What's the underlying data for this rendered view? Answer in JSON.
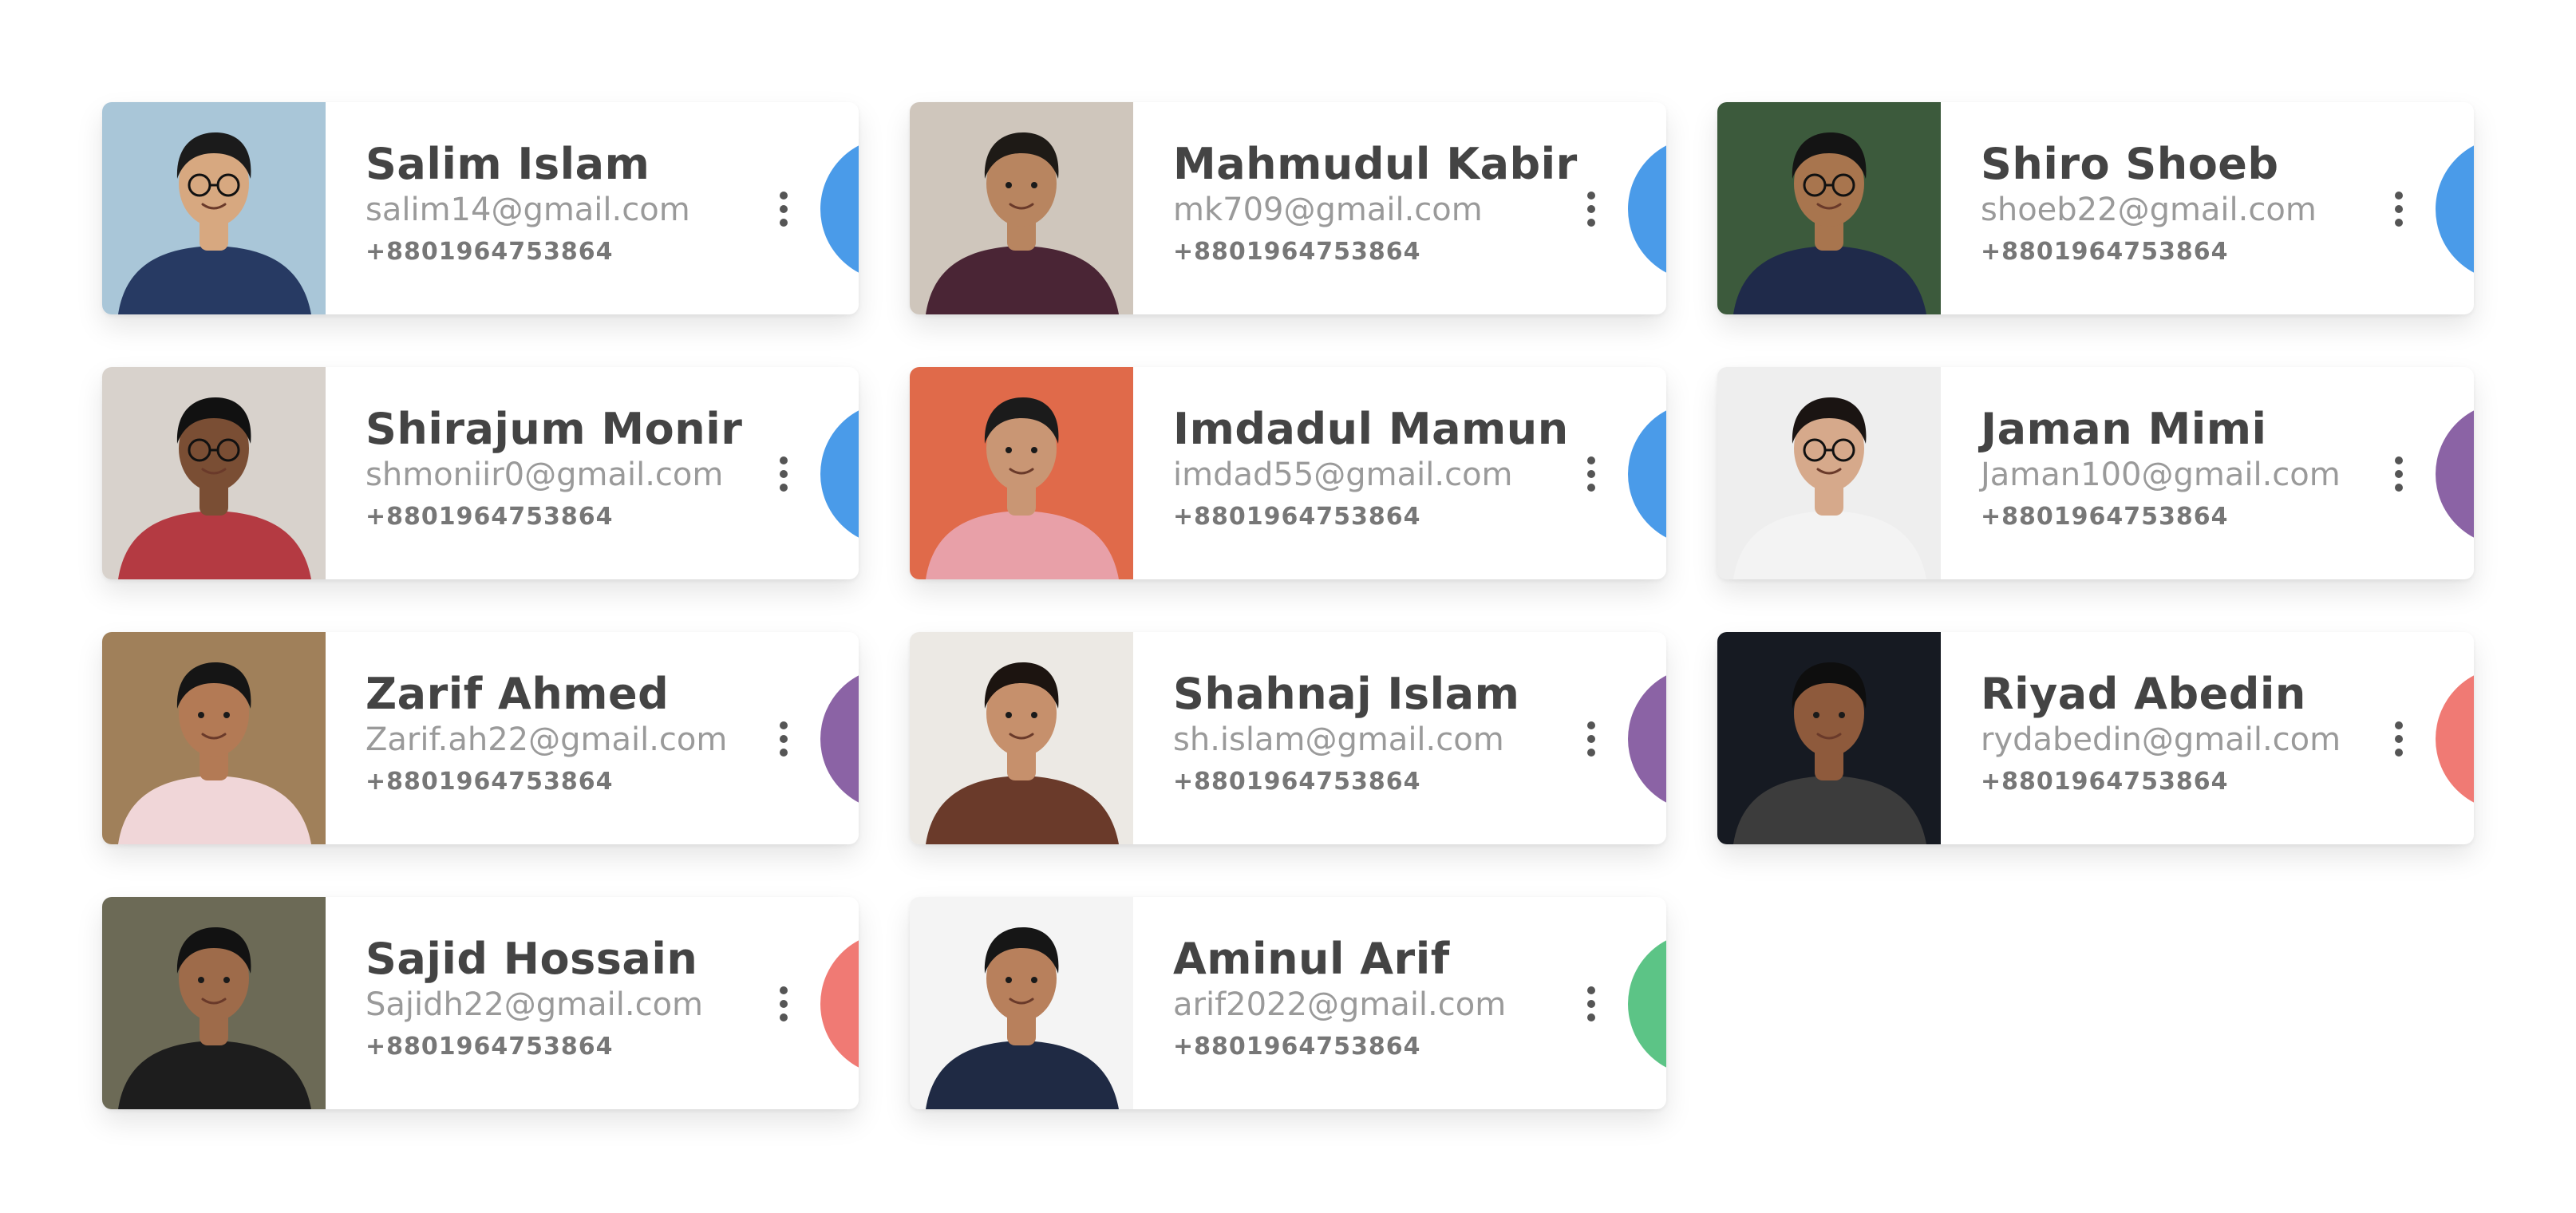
{
  "contacts": [
    {
      "name": "Salim Islam",
      "email": "salim14@gmail.com",
      "phone": "+8801964753864",
      "accent": "#4a9be9",
      "photo": {
        "bg": "#a9c6d8",
        "skin": "#d7a880",
        "hair": "#1b1b1b",
        "shirt": "#273a63",
        "glasses": true
      }
    },
    {
      "name": "Mahmudul Kabir",
      "email": "mk709@gmail.com",
      "phone": "+8801964753864",
      "accent": "#4a9be9",
      "photo": {
        "bg": "#cfc6bc",
        "skin": "#b88560",
        "hair": "#1e1a16",
        "shirt": "#4a2535",
        "glasses": false
      }
    },
    {
      "name": "Shiro Shoeb",
      "email": "shoeb22@gmail.com",
      "phone": "+8801964753864",
      "accent": "#4a9be9",
      "photo": {
        "bg": "#3c5a3c",
        "skin": "#a8754e",
        "hair": "#141414",
        "shirt": "#1f2a4a",
        "glasses": true
      }
    },
    {
      "name": "Shirajum Monir",
      "email": "shmoniir0@gmail.com",
      "phone": "+8801964753864",
      "accent": "#4a9be9",
      "photo": {
        "bg": "#d8d2cc",
        "skin": "#7a4e34",
        "hair": "#111111",
        "shirt": "#b43a42",
        "glasses": true
      }
    },
    {
      "name": "Imdadul Mamun",
      "email": "imdad55@gmail.com",
      "phone": "+8801964753864",
      "accent": "#4a9be9",
      "photo": {
        "bg": "#e06a4a",
        "skin": "#c99674",
        "hair": "#1b1b1b",
        "shirt": "#e8a0a8",
        "glasses": false
      }
    },
    {
      "name": "Jaman Mimi",
      "email": "Jaman100@gmail.com",
      "phone": "+8801964753864",
      "accent": "#8b63a5",
      "photo": {
        "bg": "#eeeeee",
        "skin": "#d6a98b",
        "hair": "#1a1412",
        "shirt": "#f3f3f3",
        "glasses": true
      }
    },
    {
      "name": "Zarif Ahmed",
      "email": "Zarif.ah22@gmail.com",
      "phone": "+8801964753864",
      "accent": "#8b63a5",
      "photo": {
        "bg": "#a0805a",
        "skin": "#b37a55",
        "hair": "#151515",
        "shirt": "#f0d6d8",
        "glasses": false
      }
    },
    {
      "name": "Shahnaj Islam",
      "email": "sh.islam@gmail.com",
      "phone": "+8801964753864",
      "accent": "#8b63a5",
      "photo": {
        "bg": "#ece9e4",
        "skin": "#c6906c",
        "hair": "#1c1410",
        "shirt": "#6a3a2a",
        "glasses": false
      }
    },
    {
      "name": "Riyad Abedin",
      "email": "rydabedin@gmail.com",
      "phone": "+8801964753864",
      "accent": "#f07a74",
      "photo": {
        "bg": "#161a22",
        "skin": "#8e5a3c",
        "hair": "#0e0e0e",
        "shirt": "#3c3c3c",
        "glasses": false
      }
    },
    {
      "name": "Sajid Hossain",
      "email": "Sajidh22@gmail.com",
      "phone": "+8801964753864",
      "accent": "#f07a74",
      "photo": {
        "bg": "#6c6a56",
        "skin": "#9e6b4a",
        "hair": "#121212",
        "shirt": "#1d1d1d",
        "glasses": false
      }
    },
    {
      "name": "Aminul Arif",
      "email": "arif2022@gmail.com",
      "phone": "+8801964753864",
      "accent": "#5cc486",
      "photo": {
        "bg": "#f4f4f4",
        "skin": "#b8805c",
        "hair": "#161616",
        "shirt": "#1f2a44",
        "glasses": false
      }
    }
  ]
}
